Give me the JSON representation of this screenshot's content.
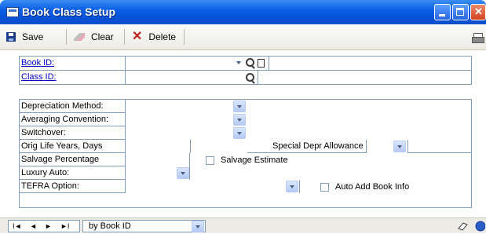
{
  "window": {
    "title": "Book Class Setup"
  },
  "toolbar": {
    "save_label": "Save",
    "clear_label": "Clear",
    "delete_label": "Delete"
  },
  "fields": {
    "book_id": {
      "label": "Book ID:",
      "value": ""
    },
    "class_id": {
      "label": "Class ID:",
      "value": ""
    },
    "depreciation_method": {
      "label": "Depreciation Method:",
      "value": ""
    },
    "averaging_convention": {
      "label": "Averaging Convention:",
      "value": ""
    },
    "switchover": {
      "label": "Switchover:",
      "value": ""
    },
    "orig_life": {
      "label": "Orig Life Years, Days",
      "years": "",
      "days": ""
    },
    "special_depr": {
      "label": "Special Depr Allowance",
      "value": ""
    },
    "salvage_percentage": {
      "label": "Salvage Percentage",
      "value": ""
    },
    "salvage_estimate": {
      "label": "Salvage Estimate",
      "checked": false
    },
    "luxury_auto": {
      "label": "Luxury Auto:",
      "value": ""
    },
    "tefra_option": {
      "label": "TEFRA Option:",
      "value": ""
    },
    "auto_add_book_info": {
      "label": "Auto Add Book Info",
      "checked": false
    }
  },
  "statusbar": {
    "nav": {
      "first": "I◄",
      "prev": "◄",
      "next": "►",
      "last": "►I"
    },
    "sort_value": "by Book ID"
  }
}
